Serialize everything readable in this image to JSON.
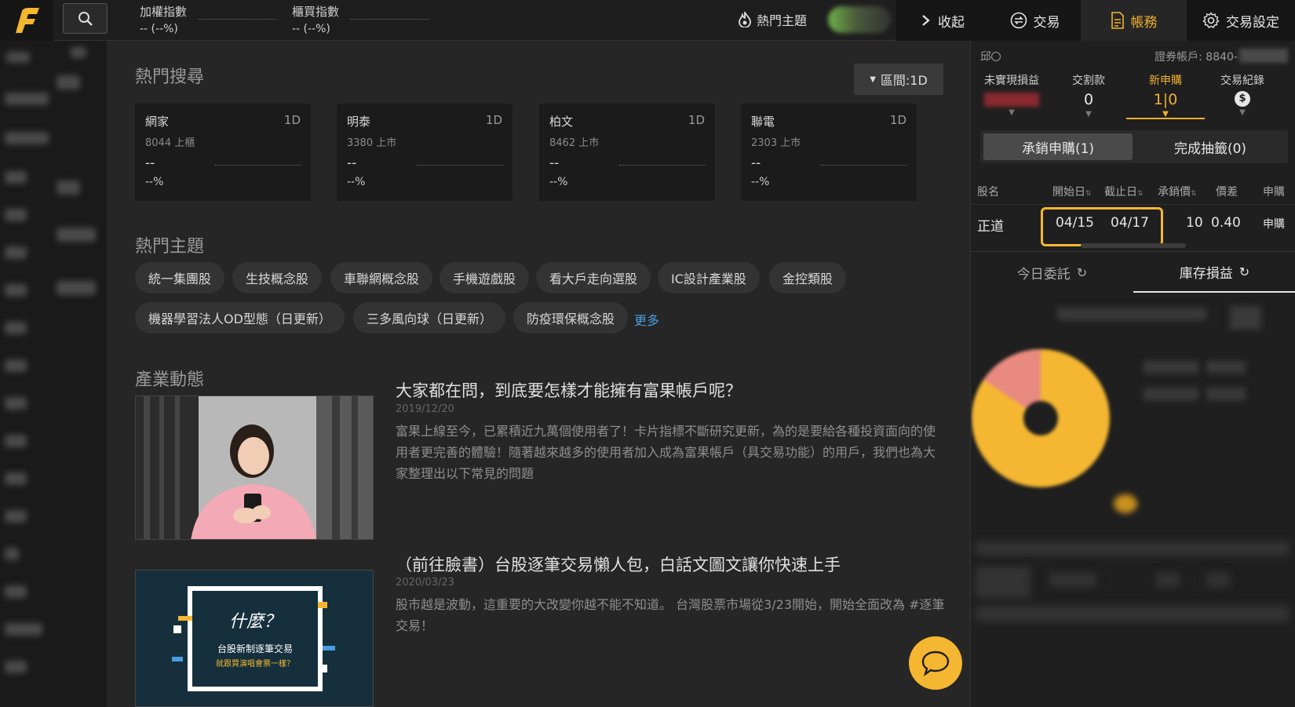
{
  "topbar": {
    "index1": {
      "label": "加權指數",
      "value": "-- (--%)"
    },
    "index2": {
      "label": "櫃買指數",
      "value": "-- (--%)"
    },
    "hot_theme": "熱門主題",
    "nav": {
      "collapse": "收起",
      "trade": "交易",
      "account": "帳務",
      "settings": "交易設定"
    },
    "accent_color": "#f0b030"
  },
  "main": {
    "hot_search": {
      "title": "熱門搜尋",
      "range_button": "區間:1D",
      "cards": [
        {
          "name": "網家",
          "period": "1D",
          "code": "8044 上櫃",
          "price": "--",
          "pct": "--%"
        },
        {
          "name": "明泰",
          "period": "1D",
          "code": "3380 上市",
          "price": "--",
          "pct": "--%"
        },
        {
          "name": "柏文",
          "period": "1D",
          "code": "8462 上市",
          "price": "--",
          "pct": "--%"
        },
        {
          "name": "聯電",
          "period": "1D",
          "code": "2303 上市",
          "price": "--",
          "pct": "--%"
        }
      ]
    },
    "hot_themes": {
      "title": "熱門主題",
      "chips": [
        "統一集團股",
        "生技概念股",
        "車聯網概念股",
        "手機遊戲股",
        "看大戶走向選股",
        "IC設計產業股",
        "金控類股",
        "機器學習法人OD型態（日更新）",
        "三多風向球（日更新）",
        "防疫環保概念股"
      ],
      "more": "更多"
    },
    "industry": {
      "title": "產業動態",
      "articles": [
        {
          "title": "大家都在問，到底要怎樣才能擁有富果帳戶呢？",
          "date": "2019/12/20",
          "body": "富果上線至今，已累積近九萬個使用者了！卡片指標不斷研究更新，為的是要給各種投資面向的使用者更完善的體驗！隨著越來越多的使用者加入成為富果帳戶（具交易功能）的用戶，我們也為大家整理出以下常見的問題"
        },
        {
          "title": "（前往臉書）台股逐筆交易懶人包，白話文圖文讓你快速上手",
          "date": "2020/03/23",
          "body": "股市越是波動，這重要的大改變你越不能不知道。 台灣股票市場從3/23開始，開始全面改為 #逐筆交易！",
          "img_text1": "什麼？",
          "img_text2": "台股新制逐筆交易",
          "img_text3": "就跟買演唱會票一樣？"
        }
      ]
    }
  },
  "right_panel": {
    "branch_prefix": "邱",
    "account_label": "證券帳戶: 8840-",
    "stats": [
      {
        "label": "未實現損益",
        "value": ""
      },
      {
        "label": "交割款",
        "value": "0"
      },
      {
        "label": "新申購",
        "value": "1|0"
      },
      {
        "label": "交易紀錄",
        "value": "$"
      }
    ],
    "sub_tabs": {
      "active": "承銷申購(1)",
      "inactive": "完成抽籤(0)"
    },
    "table": {
      "headers": [
        "股名",
        "開始日",
        "截止日",
        "承銷價",
        "價差",
        "申購"
      ],
      "rows": [
        {
          "name": "正道",
          "start": "04/15",
          "end": "04/17",
          "price": "10",
          "diff": "0.40",
          "action": "申購"
        }
      ]
    },
    "bottom_tabs": {
      "today_orders": "今日委託",
      "inventory": "庫存損益"
    }
  }
}
